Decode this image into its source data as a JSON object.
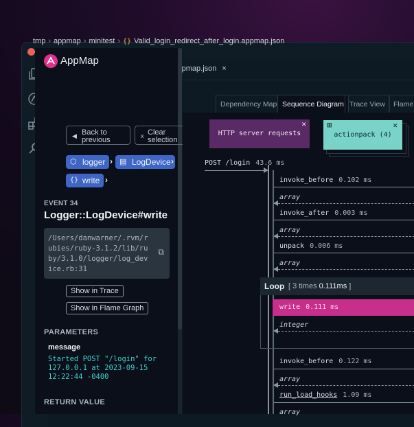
{
  "window": {
    "tab_title": "Valid_login_redirect_after_login.appmap.json",
    "tab_close": "×"
  },
  "breadcrumb": [
    "tmp",
    "appmap",
    "minitest",
    "Valid_login_redirect_after_login.appmap.json"
  ],
  "app": {
    "name": "AppMap"
  },
  "nav": {
    "back_label": "Back to previous",
    "clear_label": "Clear selection"
  },
  "chips": [
    {
      "label": "logger",
      "icon": "package-icon"
    },
    {
      "label": "LogDevice",
      "icon": "class-icon"
    },
    {
      "label": "write",
      "icon": "function-icon"
    }
  ],
  "event": {
    "label": "EVENT 34",
    "title": "Logger::LogDevice#write",
    "path": "/Users/danwarner/.rvm/rubies/ruby-3.1.2/lib/ruby/3.1.0/logger/log_device.rb:31"
  },
  "actions": {
    "show_trace": "Show in Trace",
    "show_flame": "Show in Flame Graph"
  },
  "parameters": {
    "heading": "PARAMETERS",
    "name": "message",
    "value": "Started POST \"/login\" for 127.0.0.1 at 2023-09-15 12:22:44 -0400"
  },
  "return_value": {
    "heading": "RETURN VALUE"
  },
  "views": {
    "tabs": [
      "Dependency Map",
      "Sequence Diagram",
      "Trace View",
      "Flame Graph"
    ],
    "active": "Sequence Diagram"
  },
  "sequence": {
    "actors": [
      {
        "label": "HTTP server requests"
      },
      {
        "label": "actionpack (4)"
      }
    ],
    "request": {
      "label": "POST /login",
      "time": "43.6 ms"
    },
    "calls_before_loop": [
      {
        "label": "invoke_before",
        "time": "0.102 ms",
        "returns": "array"
      },
      {
        "label": "invoke_after",
        "time": "0.003 ms",
        "returns": "array"
      },
      {
        "label": "unpack",
        "time": "0.006 ms",
        "returns": "array"
      }
    ],
    "loop": {
      "title": "Loop",
      "count": "3 times",
      "duration": "0.111ms",
      "call": {
        "label": "write",
        "time": "0.111 ms",
        "returns": "integer"
      }
    },
    "calls_after_loop": [
      {
        "label": "invoke_before",
        "time": "0.122 ms",
        "returns": "array"
      },
      {
        "label": "run_load_hooks",
        "time": "1.09 ms",
        "returns": "array"
      }
    ]
  },
  "colors": {
    "http_actor": "#5a2a66",
    "package_actor": "#79d3c9",
    "write_call": "#c82f8b",
    "chip": "#3f65c5"
  }
}
